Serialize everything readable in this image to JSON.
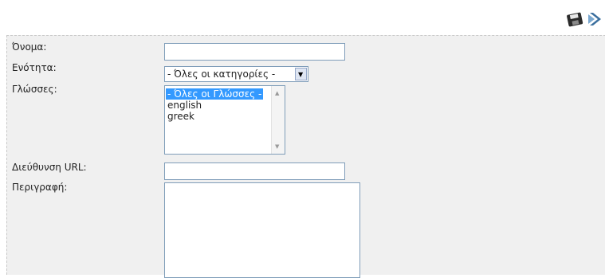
{
  "toolbar": {
    "save_icon": "save-floppy-icon",
    "next_icon": "next-arrow-icon"
  },
  "form": {
    "name_label": "Όνομα:",
    "name_value": "",
    "section_label": "Ενότητα:",
    "section_selected": "- Όλες οι κατηγορίες -",
    "languages_label": "Γλώσσες:",
    "languages_options": [
      {
        "label": "- Όλες οι Γλώσσες -",
        "selected": true
      },
      {
        "label": "english",
        "selected": false
      },
      {
        "label": "greek",
        "selected": false
      }
    ],
    "url_label": "Διεύθυνση URL:",
    "url_value": "",
    "description_label": "Περιγραφή:",
    "description_value": ""
  },
  "colors": {
    "form_background": "#f0f0f0",
    "selection": "#3399ff",
    "field_border": "#7f9db9"
  }
}
